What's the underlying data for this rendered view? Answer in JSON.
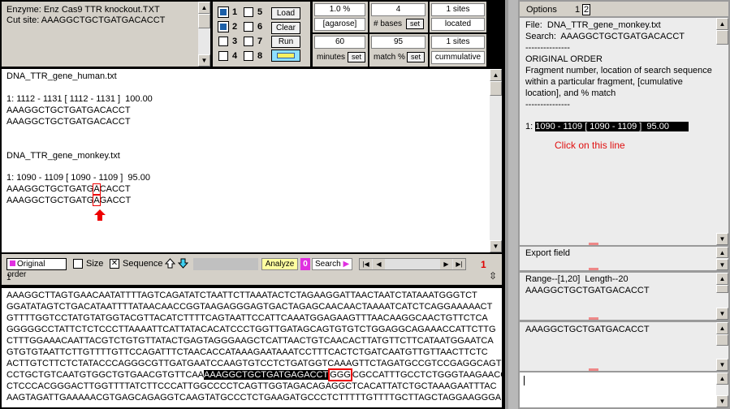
{
  "header": {
    "enzyme_line": "Enzyme: Enz Cas9 TTR knockout.TXT",
    "cutsite_line": "Cut site: AAAGGCTGCTGATGACACCT"
  },
  "options": {
    "numbers": [
      "1",
      "5",
      "2",
      "6",
      "3",
      "7",
      "4",
      "8"
    ],
    "buttons": {
      "load": "Load",
      "clear": "Clear",
      "run": "Run"
    }
  },
  "controls": {
    "agarose_value": "1.0 %",
    "agarose_label": "[agarose]",
    "bases_value": "4",
    "bases_label": "# bases",
    "sites_value_1": "1 sites",
    "sites_label_1": "located",
    "minutes_value": "60",
    "minutes_label": "minutes",
    "match_value": "95",
    "match_label": "match %",
    "sites_value_2": "1 sites",
    "sites_label_2": "cummulative",
    "set_label": "set"
  },
  "results": {
    "file1": "DNA_TTR_gene_human.txt",
    "file1_loc": "1: 1112 - 1131 [ 1112 - 1131 ]  100.00",
    "file1_seq1": "AAAGGCTGCTGATGACACCT",
    "file1_seq2": "AAAGGCTGCTGATGACACCT",
    "file2": "DNA_TTR_gene_monkey.txt",
    "file2_loc": "1: 1090 - 1109 [ 1090 - 1109 ]  95.00",
    "file2_seq1_a": "AAAGGCTGCTGATG",
    "file2_seq1_b": "A",
    "file2_seq1_c": "CACCT",
    "file2_seq2_a": "AAAGGCTGCTGATG",
    "file2_seq2_b": "A",
    "file2_seq2_c": "GACCT"
  },
  "toolbar": {
    "original_order": "Original order",
    "size": "Size",
    "sequence": "Sequence",
    "analyze": "Analyze",
    "zero": "0",
    "search": "Search",
    "count": "1",
    "bottom_num": "1"
  },
  "sequence": {
    "lines": [
      "AAAGGCTTAGTGAACAATATTTTAGTCAGATATCTAATTCTTAAATACTCTAGAAGGATTAACTAATCTATAAATGGGTCT",
      "GGATATAGTCTGACATAATTTTATAACAACCGGTAAGAGGGAGTGACTAGAGCAACAACTAAAATCATCTCAGGAAAAACT",
      "GTTTTGGTCCTATGTATGGTACGTTACATCTTTTCAGTAATTCCATTCAAATGGAGAAGTTTAACAAGGCAACTGTTCTCA",
      "GGGGGCCTATTCTCTCCCTTAAAATTCATTATACACATCCCTGGTTGATAGCAGTGTGTCTGGAGGCAGAAACCATTCTTG",
      "CTTTGGAAACAATTACGTCTGTGTTATACTGAGTAGGGAAGCTCATTAACTGTCAACACTTATGTTCTTCATAATGGAATCA",
      "GTGTGTAATTCTTGTTTTGTTCCAGATTTCTAACACCATAAAGAATAAATCCTTTCACTCTGATCAATGTTGTTAACTTCTC",
      "ACTTGTCTTCTCTATACCCAGGGCGTTGATGAATCCAAGTGTCCTCTGATGGTCAAAGTTCTAGATGCCGTCCGAGGCAGT"
    ],
    "line8_a": "CCTGCTGTCAATGTGGCTGTGAACGTGTTCAA",
    "line8_hl": "AAAGGCTGCTGATGAGACCT",
    "line8_box": "GGG",
    "line8_c": "CGCCATTTGCCTCTGGGTAAGAACC",
    "line9": "CTCCCACGGGACTTGGTTTTATCTTCCCATTGGCCCCTCAGTTGGTAGACAGAGGCTCACATTATCTGCTAAAGAATTTAC",
    "line10": "AAGTAGATTGAAAAACGTGAGCAGAGGTCAAGTATGCCCTCTGAAGATGCCCTCTTTTTGTTTTGCTTAGCTAGGAAGGGA"
  },
  "right": {
    "options_label": "Options",
    "tab1": "1",
    "tab2": "2",
    "file_line": "File:  DNA_TTR_gene_monkey.txt",
    "search_line": "Search:  AAAGGCTGCTGATGACACCT",
    "dashes": "---------------",
    "orig_order": "ORIGINAL ORDER",
    "desc1": "Fragment number, location of search sequence",
    "desc2": "within a particular fragment, [cumulative",
    "desc3": "location], and % match",
    "selected_prefix": "1: ",
    "selected_line": "1090 - 1109 [ 1090 - 1109 ]  95.00",
    "annotation": "Click on this line",
    "export_label": "Export field",
    "range_line": "Range--[1,20]  Length--20",
    "range_seq": "AAAGGCTGCTGATGACACCT",
    "seq2": "AAAGGCTGCTGATGACACCT"
  },
  "colors": {
    "highlight": "#000000",
    "annotation": "#e01010",
    "accent": "#1b5fa8"
  }
}
